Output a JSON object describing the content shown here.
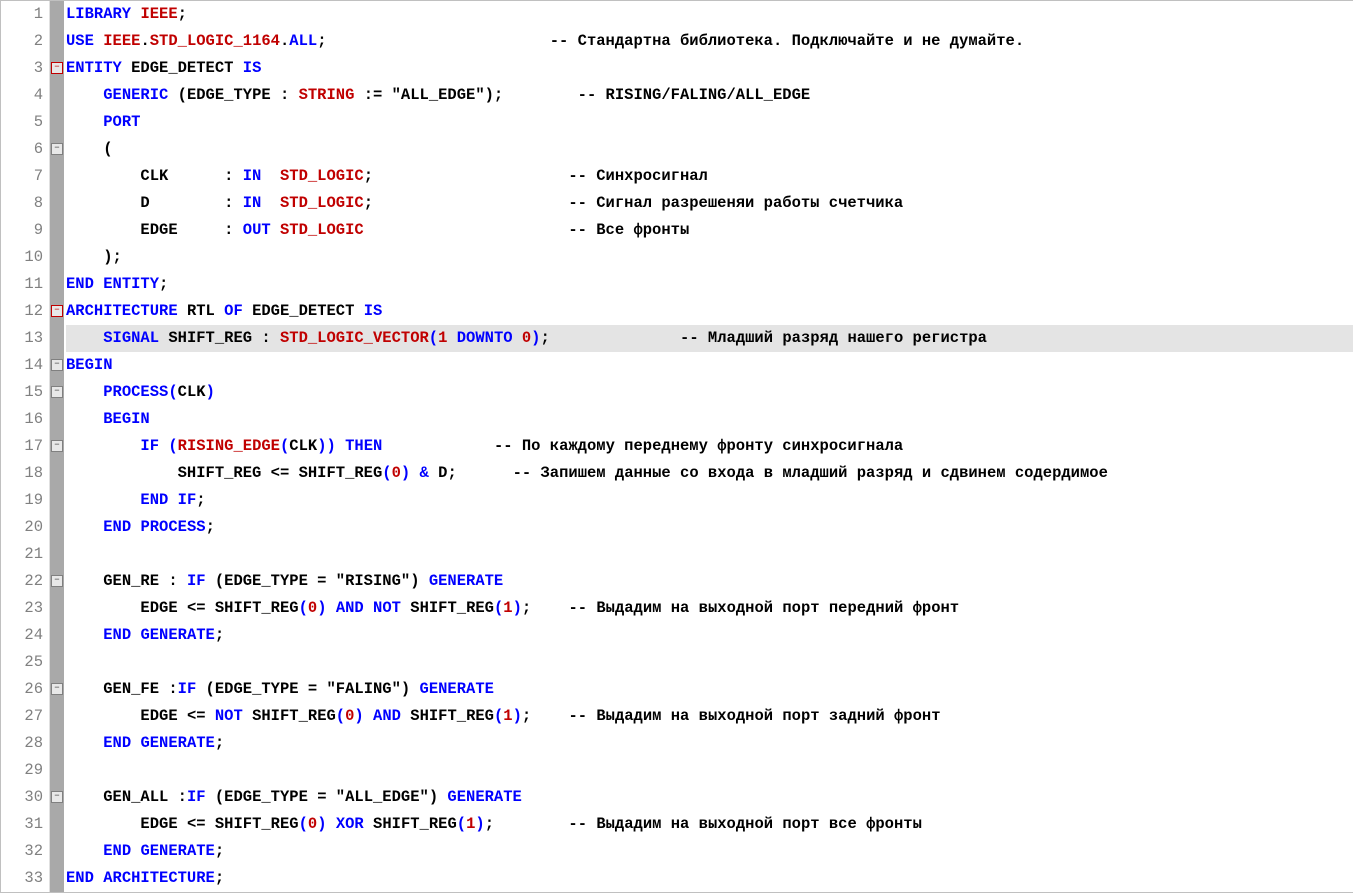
{
  "highlighted_line": 13,
  "fold_markers": {
    "3": {
      "type": "minus",
      "color": "red"
    },
    "6": {
      "type": "minus",
      "color": "gray"
    },
    "12": {
      "type": "minus",
      "color": "red"
    },
    "14": {
      "type": "minus",
      "color": "gray"
    },
    "15": {
      "type": "minus",
      "color": "gray"
    },
    "17": {
      "type": "minus",
      "color": "gray"
    },
    "22": {
      "type": "minus",
      "color": "gray"
    },
    "26": {
      "type": "minus",
      "color": "gray"
    },
    "30": {
      "type": "minus",
      "color": "gray"
    }
  },
  "lines": [
    [
      {
        "c": "kw-blue",
        "t": "LIBRARY"
      },
      {
        "c": "punct",
        "t": " "
      },
      {
        "c": "kw-red",
        "t": "IEEE"
      },
      {
        "c": "punct",
        "t": ";"
      }
    ],
    [
      {
        "c": "kw-blue",
        "t": "USE"
      },
      {
        "c": "punct",
        "t": " "
      },
      {
        "c": "kw-red",
        "t": "IEEE"
      },
      {
        "c": "punct",
        "t": "."
      },
      {
        "c": "kw-red",
        "t": "STD_LOGIC_1164"
      },
      {
        "c": "punct",
        "t": "."
      },
      {
        "c": "kw-blue",
        "t": "ALL"
      },
      {
        "c": "punct",
        "t": ";"
      },
      {
        "c": "comment",
        "t": "                        -- Стандартна библиотека. Подключайте и не думайте."
      }
    ],
    [
      {
        "c": "kw-blue",
        "t": "ENTITY"
      },
      {
        "c": "punct",
        "t": " "
      },
      {
        "c": "ident",
        "t": "EDGE_DETECT"
      },
      {
        "c": "punct",
        "t": " "
      },
      {
        "c": "kw-blue",
        "t": "IS"
      }
    ],
    [
      {
        "c": "punct",
        "t": "    "
      },
      {
        "c": "kw-blue",
        "t": "GENERIC"
      },
      {
        "c": "punct",
        "t": " ("
      },
      {
        "c": "ident",
        "t": "EDGE_TYPE"
      },
      {
        "c": "punct",
        "t": " : "
      },
      {
        "c": "kw-red",
        "t": "STRING"
      },
      {
        "c": "punct",
        "t": " := "
      },
      {
        "c": "kw-black",
        "t": "\"ALL_EDGE\""
      },
      {
        "c": "punct",
        "t": ");"
      },
      {
        "c": "comment",
        "t": "        -- RISING/FALING/ALL_EDGE"
      }
    ],
    [
      {
        "c": "punct",
        "t": "    "
      },
      {
        "c": "kw-blue",
        "t": "PORT"
      }
    ],
    [
      {
        "c": "punct",
        "t": "    ("
      }
    ],
    [
      {
        "c": "punct",
        "t": "        "
      },
      {
        "c": "ident",
        "t": "CLK"
      },
      {
        "c": "punct",
        "t": "      : "
      },
      {
        "c": "kw-blue",
        "t": "IN"
      },
      {
        "c": "punct",
        "t": "  "
      },
      {
        "c": "kw-red",
        "t": "STD_LOGIC"
      },
      {
        "c": "punct",
        "t": ";"
      },
      {
        "c": "comment",
        "t": "                     -- Синхросигнал"
      }
    ],
    [
      {
        "c": "punct",
        "t": "        "
      },
      {
        "c": "ident",
        "t": "D"
      },
      {
        "c": "punct",
        "t": "        : "
      },
      {
        "c": "kw-blue",
        "t": "IN"
      },
      {
        "c": "punct",
        "t": "  "
      },
      {
        "c": "kw-red",
        "t": "STD_LOGIC"
      },
      {
        "c": "punct",
        "t": ";"
      },
      {
        "c": "comment",
        "t": "                     -- Сигнал разрешеняи работы счетчика"
      }
    ],
    [
      {
        "c": "punct",
        "t": "        "
      },
      {
        "c": "ident",
        "t": "EDGE"
      },
      {
        "c": "punct",
        "t": "     : "
      },
      {
        "c": "kw-blue",
        "t": "OUT"
      },
      {
        "c": "punct",
        "t": " "
      },
      {
        "c": "kw-red",
        "t": "STD_LOGIC"
      },
      {
        "c": "comment",
        "t": "                      -- Все фронты"
      }
    ],
    [
      {
        "c": "punct",
        "t": "    );"
      }
    ],
    [
      {
        "c": "kw-blue",
        "t": "END"
      },
      {
        "c": "punct",
        "t": " "
      },
      {
        "c": "kw-blue",
        "t": "ENTITY"
      },
      {
        "c": "punct",
        "t": ";"
      }
    ],
    [
      {
        "c": "kw-blue",
        "t": "ARCHITECTURE"
      },
      {
        "c": "punct",
        "t": " "
      },
      {
        "c": "ident",
        "t": "RTL"
      },
      {
        "c": "punct",
        "t": " "
      },
      {
        "c": "kw-blue",
        "t": "OF"
      },
      {
        "c": "punct",
        "t": " "
      },
      {
        "c": "ident",
        "t": "EDGE_DETECT"
      },
      {
        "c": "punct",
        "t": " "
      },
      {
        "c": "kw-blue",
        "t": "IS"
      }
    ],
    [
      {
        "c": "punct",
        "t": "    "
      },
      {
        "c": "kw-blue",
        "t": "SIGNAL"
      },
      {
        "c": "punct",
        "t": " "
      },
      {
        "c": "ident",
        "t": "SHIFT_REG"
      },
      {
        "c": "punct",
        "t": " : "
      },
      {
        "c": "kw-red",
        "t": "STD_LOGIC_VECTOR"
      },
      {
        "c": "paren-blue",
        "t": "("
      },
      {
        "c": "num",
        "t": "1"
      },
      {
        "c": "punct",
        "t": " "
      },
      {
        "c": "kw-blue",
        "t": "DOWNTO"
      },
      {
        "c": "punct",
        "t": " "
      },
      {
        "c": "num",
        "t": "0"
      },
      {
        "c": "paren-blue",
        "t": ")"
      },
      {
        "c": "punct",
        "t": ";"
      },
      {
        "c": "comment",
        "t": "              -- Младший разряд нашего регистра"
      }
    ],
    [
      {
        "c": "kw-blue",
        "t": "BEGIN"
      }
    ],
    [
      {
        "c": "punct",
        "t": "    "
      },
      {
        "c": "kw-blue",
        "t": "PROCESS"
      },
      {
        "c": "paren-blue",
        "t": "("
      },
      {
        "c": "ident",
        "t": "CLK"
      },
      {
        "c": "paren-blue",
        "t": ")"
      }
    ],
    [
      {
        "c": "punct",
        "t": "    "
      },
      {
        "c": "kw-blue",
        "t": "BEGIN"
      }
    ],
    [
      {
        "c": "punct",
        "t": "        "
      },
      {
        "c": "kw-blue",
        "t": "IF"
      },
      {
        "c": "punct",
        "t": " "
      },
      {
        "c": "paren-blue",
        "t": "("
      },
      {
        "c": "kw-red",
        "t": "RISING_EDGE"
      },
      {
        "c": "paren-blue",
        "t": "("
      },
      {
        "c": "ident",
        "t": "CLK"
      },
      {
        "c": "paren-blue",
        "t": "))"
      },
      {
        "c": "punct",
        "t": " "
      },
      {
        "c": "kw-blue",
        "t": "THEN"
      },
      {
        "c": "comment",
        "t": "            -- По каждому переднему фронту синхросигнала"
      }
    ],
    [
      {
        "c": "punct",
        "t": "            "
      },
      {
        "c": "ident",
        "t": "SHIFT_REG"
      },
      {
        "c": "punct",
        "t": " <= "
      },
      {
        "c": "ident",
        "t": "SHIFT_REG"
      },
      {
        "c": "paren-blue",
        "t": "("
      },
      {
        "c": "num",
        "t": "0"
      },
      {
        "c": "paren-blue",
        "t": ")"
      },
      {
        "c": "punct",
        "t": " "
      },
      {
        "c": "kw-blue",
        "t": "&"
      },
      {
        "c": "punct",
        "t": " "
      },
      {
        "c": "ident",
        "t": "D"
      },
      {
        "c": "punct",
        "t": ";"
      },
      {
        "c": "comment",
        "t": "      -- Запишем данные со входа в младший разряд и сдвинем содердимое"
      }
    ],
    [
      {
        "c": "punct",
        "t": "        "
      },
      {
        "c": "kw-blue",
        "t": "END"
      },
      {
        "c": "punct",
        "t": " "
      },
      {
        "c": "kw-blue",
        "t": "IF"
      },
      {
        "c": "punct",
        "t": ";"
      }
    ],
    [
      {
        "c": "punct",
        "t": "    "
      },
      {
        "c": "kw-blue",
        "t": "END"
      },
      {
        "c": "punct",
        "t": " "
      },
      {
        "c": "kw-blue",
        "t": "PROCESS"
      },
      {
        "c": "punct",
        "t": ";"
      }
    ],
    [
      {
        "c": "punct",
        "t": ""
      }
    ],
    [
      {
        "c": "punct",
        "t": "    "
      },
      {
        "c": "ident",
        "t": "GEN_RE"
      },
      {
        "c": "punct",
        "t": " : "
      },
      {
        "c": "kw-blue",
        "t": "IF"
      },
      {
        "c": "punct",
        "t": " ("
      },
      {
        "c": "ident",
        "t": "EDGE_TYPE"
      },
      {
        "c": "punct",
        "t": " = "
      },
      {
        "c": "kw-black",
        "t": "\"RISING\""
      },
      {
        "c": "punct",
        "t": ") "
      },
      {
        "c": "kw-blue",
        "t": "GENERATE"
      }
    ],
    [
      {
        "c": "punct",
        "t": "        "
      },
      {
        "c": "ident",
        "t": "EDGE"
      },
      {
        "c": "punct",
        "t": " <= "
      },
      {
        "c": "ident",
        "t": "SHIFT_REG"
      },
      {
        "c": "paren-blue",
        "t": "("
      },
      {
        "c": "num",
        "t": "0"
      },
      {
        "c": "paren-blue",
        "t": ")"
      },
      {
        "c": "punct",
        "t": " "
      },
      {
        "c": "kw-blue",
        "t": "AND"
      },
      {
        "c": "punct",
        "t": " "
      },
      {
        "c": "kw-blue",
        "t": "NOT"
      },
      {
        "c": "punct",
        "t": " "
      },
      {
        "c": "ident",
        "t": "SHIFT_REG"
      },
      {
        "c": "paren-blue",
        "t": "("
      },
      {
        "c": "num",
        "t": "1"
      },
      {
        "c": "paren-blue",
        "t": ")"
      },
      {
        "c": "punct",
        "t": ";"
      },
      {
        "c": "comment",
        "t": "    -- Выдадим на выходной порт передний фронт"
      }
    ],
    [
      {
        "c": "punct",
        "t": "    "
      },
      {
        "c": "kw-blue",
        "t": "END"
      },
      {
        "c": "punct",
        "t": " "
      },
      {
        "c": "kw-blue",
        "t": "GENERATE"
      },
      {
        "c": "punct",
        "t": ";"
      }
    ],
    [
      {
        "c": "punct",
        "t": ""
      }
    ],
    [
      {
        "c": "punct",
        "t": "    "
      },
      {
        "c": "ident",
        "t": "GEN_FE"
      },
      {
        "c": "punct",
        "t": " :"
      },
      {
        "c": "kw-blue",
        "t": "IF"
      },
      {
        "c": "punct",
        "t": " ("
      },
      {
        "c": "ident",
        "t": "EDGE_TYPE"
      },
      {
        "c": "punct",
        "t": " = "
      },
      {
        "c": "kw-black",
        "t": "\"FALING\""
      },
      {
        "c": "punct",
        "t": ") "
      },
      {
        "c": "kw-blue",
        "t": "GENERATE"
      }
    ],
    [
      {
        "c": "punct",
        "t": "        "
      },
      {
        "c": "ident",
        "t": "EDGE"
      },
      {
        "c": "punct",
        "t": " <= "
      },
      {
        "c": "kw-blue",
        "t": "NOT"
      },
      {
        "c": "punct",
        "t": " "
      },
      {
        "c": "ident",
        "t": "SHIFT_REG"
      },
      {
        "c": "paren-blue",
        "t": "("
      },
      {
        "c": "num",
        "t": "0"
      },
      {
        "c": "paren-blue",
        "t": ")"
      },
      {
        "c": "punct",
        "t": " "
      },
      {
        "c": "kw-blue",
        "t": "AND"
      },
      {
        "c": "punct",
        "t": " "
      },
      {
        "c": "ident",
        "t": "SHIFT_REG"
      },
      {
        "c": "paren-blue",
        "t": "("
      },
      {
        "c": "num",
        "t": "1"
      },
      {
        "c": "paren-blue",
        "t": ")"
      },
      {
        "c": "punct",
        "t": ";"
      },
      {
        "c": "comment",
        "t": "    -- Выдадим на выходной порт задний фронт"
      }
    ],
    [
      {
        "c": "punct",
        "t": "    "
      },
      {
        "c": "kw-blue",
        "t": "END"
      },
      {
        "c": "punct",
        "t": " "
      },
      {
        "c": "kw-blue",
        "t": "GENERATE"
      },
      {
        "c": "punct",
        "t": ";"
      }
    ],
    [
      {
        "c": "punct",
        "t": ""
      }
    ],
    [
      {
        "c": "punct",
        "t": "    "
      },
      {
        "c": "ident",
        "t": "GEN_ALL"
      },
      {
        "c": "punct",
        "t": " :"
      },
      {
        "c": "kw-blue",
        "t": "IF"
      },
      {
        "c": "punct",
        "t": " ("
      },
      {
        "c": "ident",
        "t": "EDGE_TYPE"
      },
      {
        "c": "punct",
        "t": " = "
      },
      {
        "c": "kw-black",
        "t": "\"ALL_EDGE\""
      },
      {
        "c": "punct",
        "t": ") "
      },
      {
        "c": "kw-blue",
        "t": "GENERATE"
      }
    ],
    [
      {
        "c": "punct",
        "t": "        "
      },
      {
        "c": "ident",
        "t": "EDGE"
      },
      {
        "c": "punct",
        "t": " <= "
      },
      {
        "c": "ident",
        "t": "SHIFT_REG"
      },
      {
        "c": "paren-blue",
        "t": "("
      },
      {
        "c": "num",
        "t": "0"
      },
      {
        "c": "paren-blue",
        "t": ")"
      },
      {
        "c": "punct",
        "t": " "
      },
      {
        "c": "kw-blue",
        "t": "XOR"
      },
      {
        "c": "punct",
        "t": " "
      },
      {
        "c": "ident",
        "t": "SHIFT_REG"
      },
      {
        "c": "paren-blue",
        "t": "("
      },
      {
        "c": "num",
        "t": "1"
      },
      {
        "c": "paren-blue",
        "t": ")"
      },
      {
        "c": "punct",
        "t": ";"
      },
      {
        "c": "comment",
        "t": "        -- Выдадим на выходной порт все фронты"
      }
    ],
    [
      {
        "c": "punct",
        "t": "    "
      },
      {
        "c": "kw-blue",
        "t": "END"
      },
      {
        "c": "punct",
        "t": " "
      },
      {
        "c": "kw-blue",
        "t": "GENERATE"
      },
      {
        "c": "punct",
        "t": ";"
      }
    ],
    [
      {
        "c": "kw-blue",
        "t": "END"
      },
      {
        "c": "punct",
        "t": " "
      },
      {
        "c": "kw-blue",
        "t": "ARCHITECTURE"
      },
      {
        "c": "punct",
        "t": ";"
      }
    ]
  ]
}
